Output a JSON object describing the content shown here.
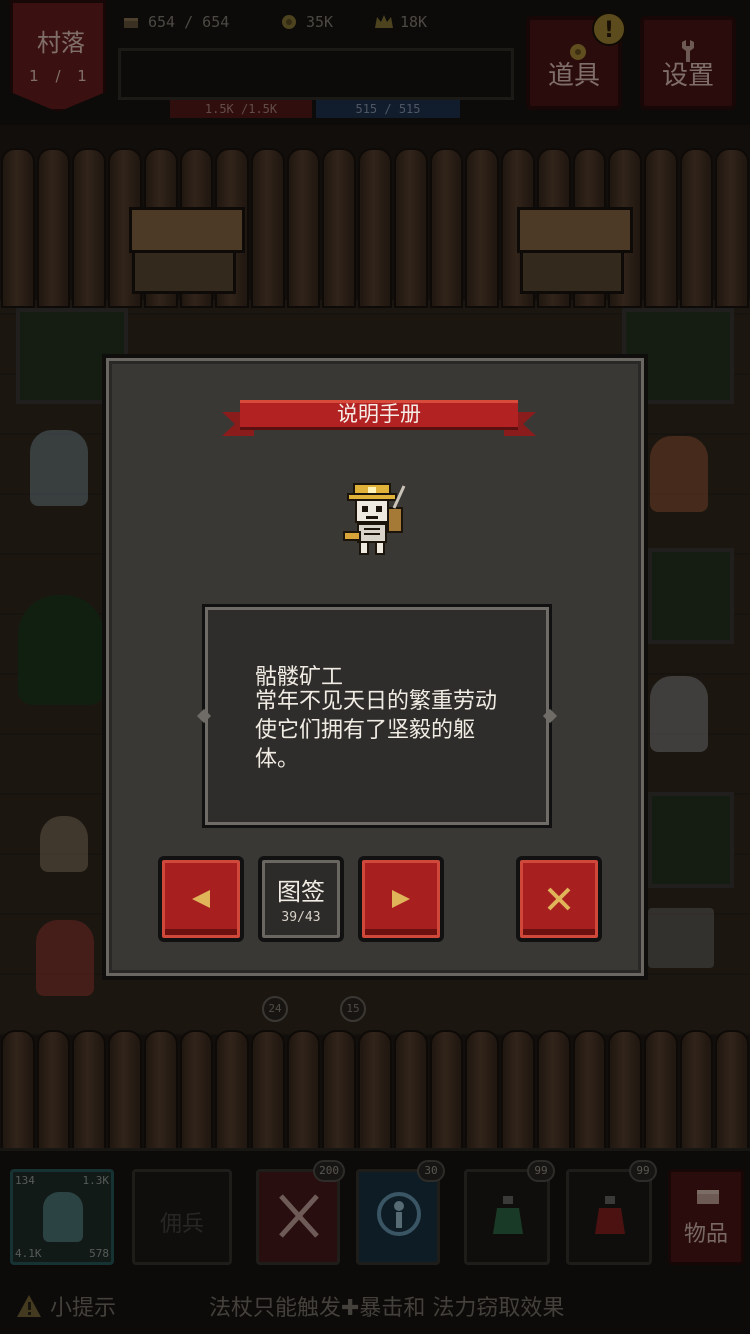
{
  "hud": {
    "village": {
      "title": "村落",
      "level": "1 / 1"
    },
    "stats": {
      "population": "654 / 654",
      "gold": "35K",
      "crown": "18K"
    },
    "hp": "1.5K /1.5K",
    "mp": "515 / 515",
    "items_button": "道具",
    "settings_button": "设置",
    "alert_badge": "!"
  },
  "dialog": {
    "title": "说明手册",
    "monster_name": "骷髅矿工",
    "description": "常年不见天日的繁重劳动使它们拥有了坚毅的躯体。",
    "prev_icon": "left-arrow-icon",
    "next_icon": "right-arrow-icon",
    "close_icon": "close-x-icon",
    "catalog_label": "图签",
    "catalog_count": "39/43"
  },
  "scene": {
    "badges": [
      "24",
      "15"
    ]
  },
  "bottom": {
    "hero": {
      "stat_top_left": "134",
      "stat_top_right": "1.3K",
      "stat_bottom_left": "4.1K",
      "stat_bottom_right": "578"
    },
    "mercenary_label": "佣兵",
    "skill1_count": "200",
    "skill2_count": "30",
    "potion1_count": "99",
    "potion2_count": "99",
    "goods_button": "物品",
    "tip_label": "小提示",
    "tip_text": "法杖只能触发✚暴击和 法力窃取效果"
  },
  "colors": {
    "accent_red": "#a71f1f",
    "panel": "#3a3835",
    "hp": "#5a1a1a",
    "mp": "#1f3450"
  }
}
